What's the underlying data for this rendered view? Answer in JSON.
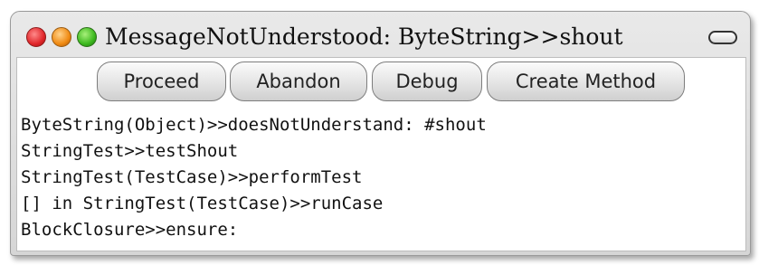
{
  "window": {
    "title": "MessageNotUnderstood: ByteString>>shout"
  },
  "buttons": {
    "proceed": "Proceed",
    "abandon": "Abandon",
    "debug": "Debug",
    "create_method": "Create Method"
  },
  "stack_trace": [
    "ByteString(Object)>>doesNotUnderstand: #shout",
    "StringTest>>testShout",
    "StringTest(TestCase)>>performTest",
    "[] in StringTest(TestCase)>>runCase",
    "BlockClosure>>ensure:"
  ],
  "icons": {
    "close": "close-icon",
    "minimize": "minimize-icon",
    "maximize": "maximize-icon",
    "collapse": "collapse-icon"
  },
  "colors": {
    "close": "#e0262a",
    "minimize": "#f08a12",
    "maximize": "#3cb81e"
  }
}
